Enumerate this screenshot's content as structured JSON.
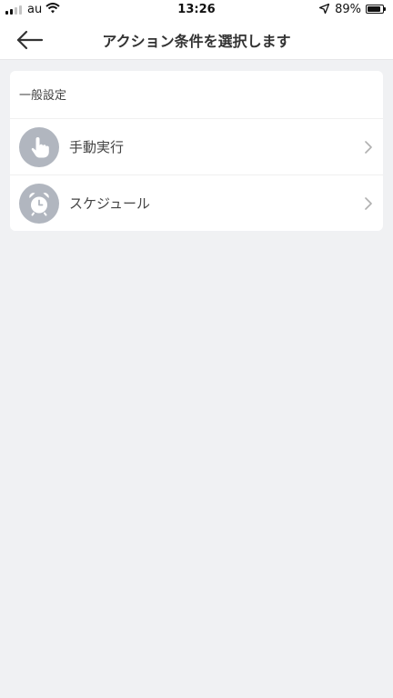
{
  "status_bar": {
    "carrier": "au",
    "time": "13:26",
    "battery_percent_text": "89%",
    "battery_level": 0.89,
    "signal_bars_filled": 2,
    "signal_bars_total": 4
  },
  "header": {
    "title": "アクション条件を選択します",
    "back_icon": "arrow-left-icon"
  },
  "section": {
    "title": "一般設定",
    "items": [
      {
        "label": "手動実行",
        "icon": "hand-pointer-icon"
      },
      {
        "label": "スケジュール",
        "icon": "alarm-clock-icon"
      }
    ]
  },
  "colors": {
    "background": "#f0f1f3",
    "card": "#ffffff",
    "icon_circle": "#b1b6bf",
    "text": "#333333",
    "chevron": "#b0b0b0"
  }
}
